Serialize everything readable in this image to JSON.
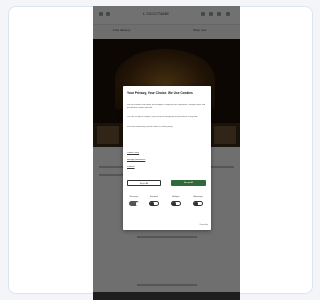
{
  "header": {
    "brand": "L'OCCITANE"
  },
  "subbar": {
    "left": "Free delivery",
    "right": "Shop now"
  },
  "consent": {
    "title": "Your Privacy, Your Choice. We Use Cookies",
    "paragraphs": [
      "We use cookies and similar technologies to improve your experience, analyse traffic and personalise content and ads.",
      "You can accept all cookies, reject them or manage your preferences at any time.",
      "For more information, please read our cookie policy."
    ],
    "links": [
      "Cookie Policy",
      "Manage preferences",
      "Partners"
    ],
    "reject_label": "Reject All",
    "accept_label": "Accept All",
    "categories": [
      {
        "label": "Necessary",
        "on": true
      },
      {
        "label": "Functional",
        "on": false
      },
      {
        "label": "Analytics",
        "on": false
      },
      {
        "label": "Advertising",
        "on": false
      }
    ],
    "powered_by": "Powered by"
  },
  "colors": {
    "accent": "#2f6b3a",
    "scrim": "#000000"
  }
}
